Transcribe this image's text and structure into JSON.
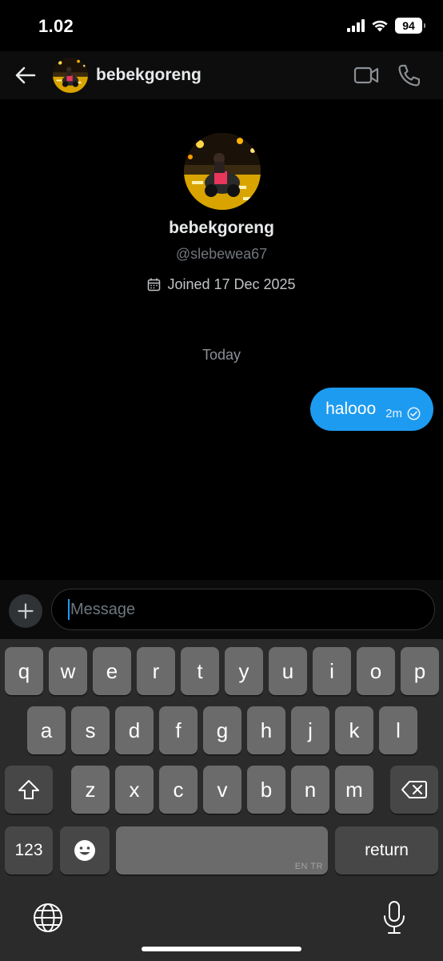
{
  "status_bar": {
    "time": "1.02",
    "battery": "94"
  },
  "header": {
    "name": "bebekgoreng"
  },
  "profile": {
    "name": "bebekgoreng",
    "handle": "@slebewea67",
    "joined": "Joined 17 Dec 2025"
  },
  "conversation": {
    "day_label": "Today",
    "messages": [
      {
        "text": "halooo",
        "time": "2m",
        "status": "sent",
        "direction": "outgoing"
      }
    ]
  },
  "composer": {
    "placeholder": "Message"
  },
  "keyboard": {
    "row1": [
      "q",
      "w",
      "e",
      "r",
      "t",
      "y",
      "u",
      "i",
      "o",
      "p"
    ],
    "row2": [
      "a",
      "s",
      "d",
      "f",
      "g",
      "h",
      "j",
      "k",
      "l"
    ],
    "row3": [
      "z",
      "x",
      "c",
      "v",
      "b",
      "n",
      "m"
    ],
    "numbers_label": "123",
    "return_label": "return",
    "space_hint": "EN TR"
  },
  "colors": {
    "accent": "#1d9bf0",
    "background": "#000000",
    "header_background": "#0d0d0d",
    "keyboard_background": "#2b2b2b",
    "key_light": "#6b6b6b",
    "key_dark": "#474747"
  }
}
